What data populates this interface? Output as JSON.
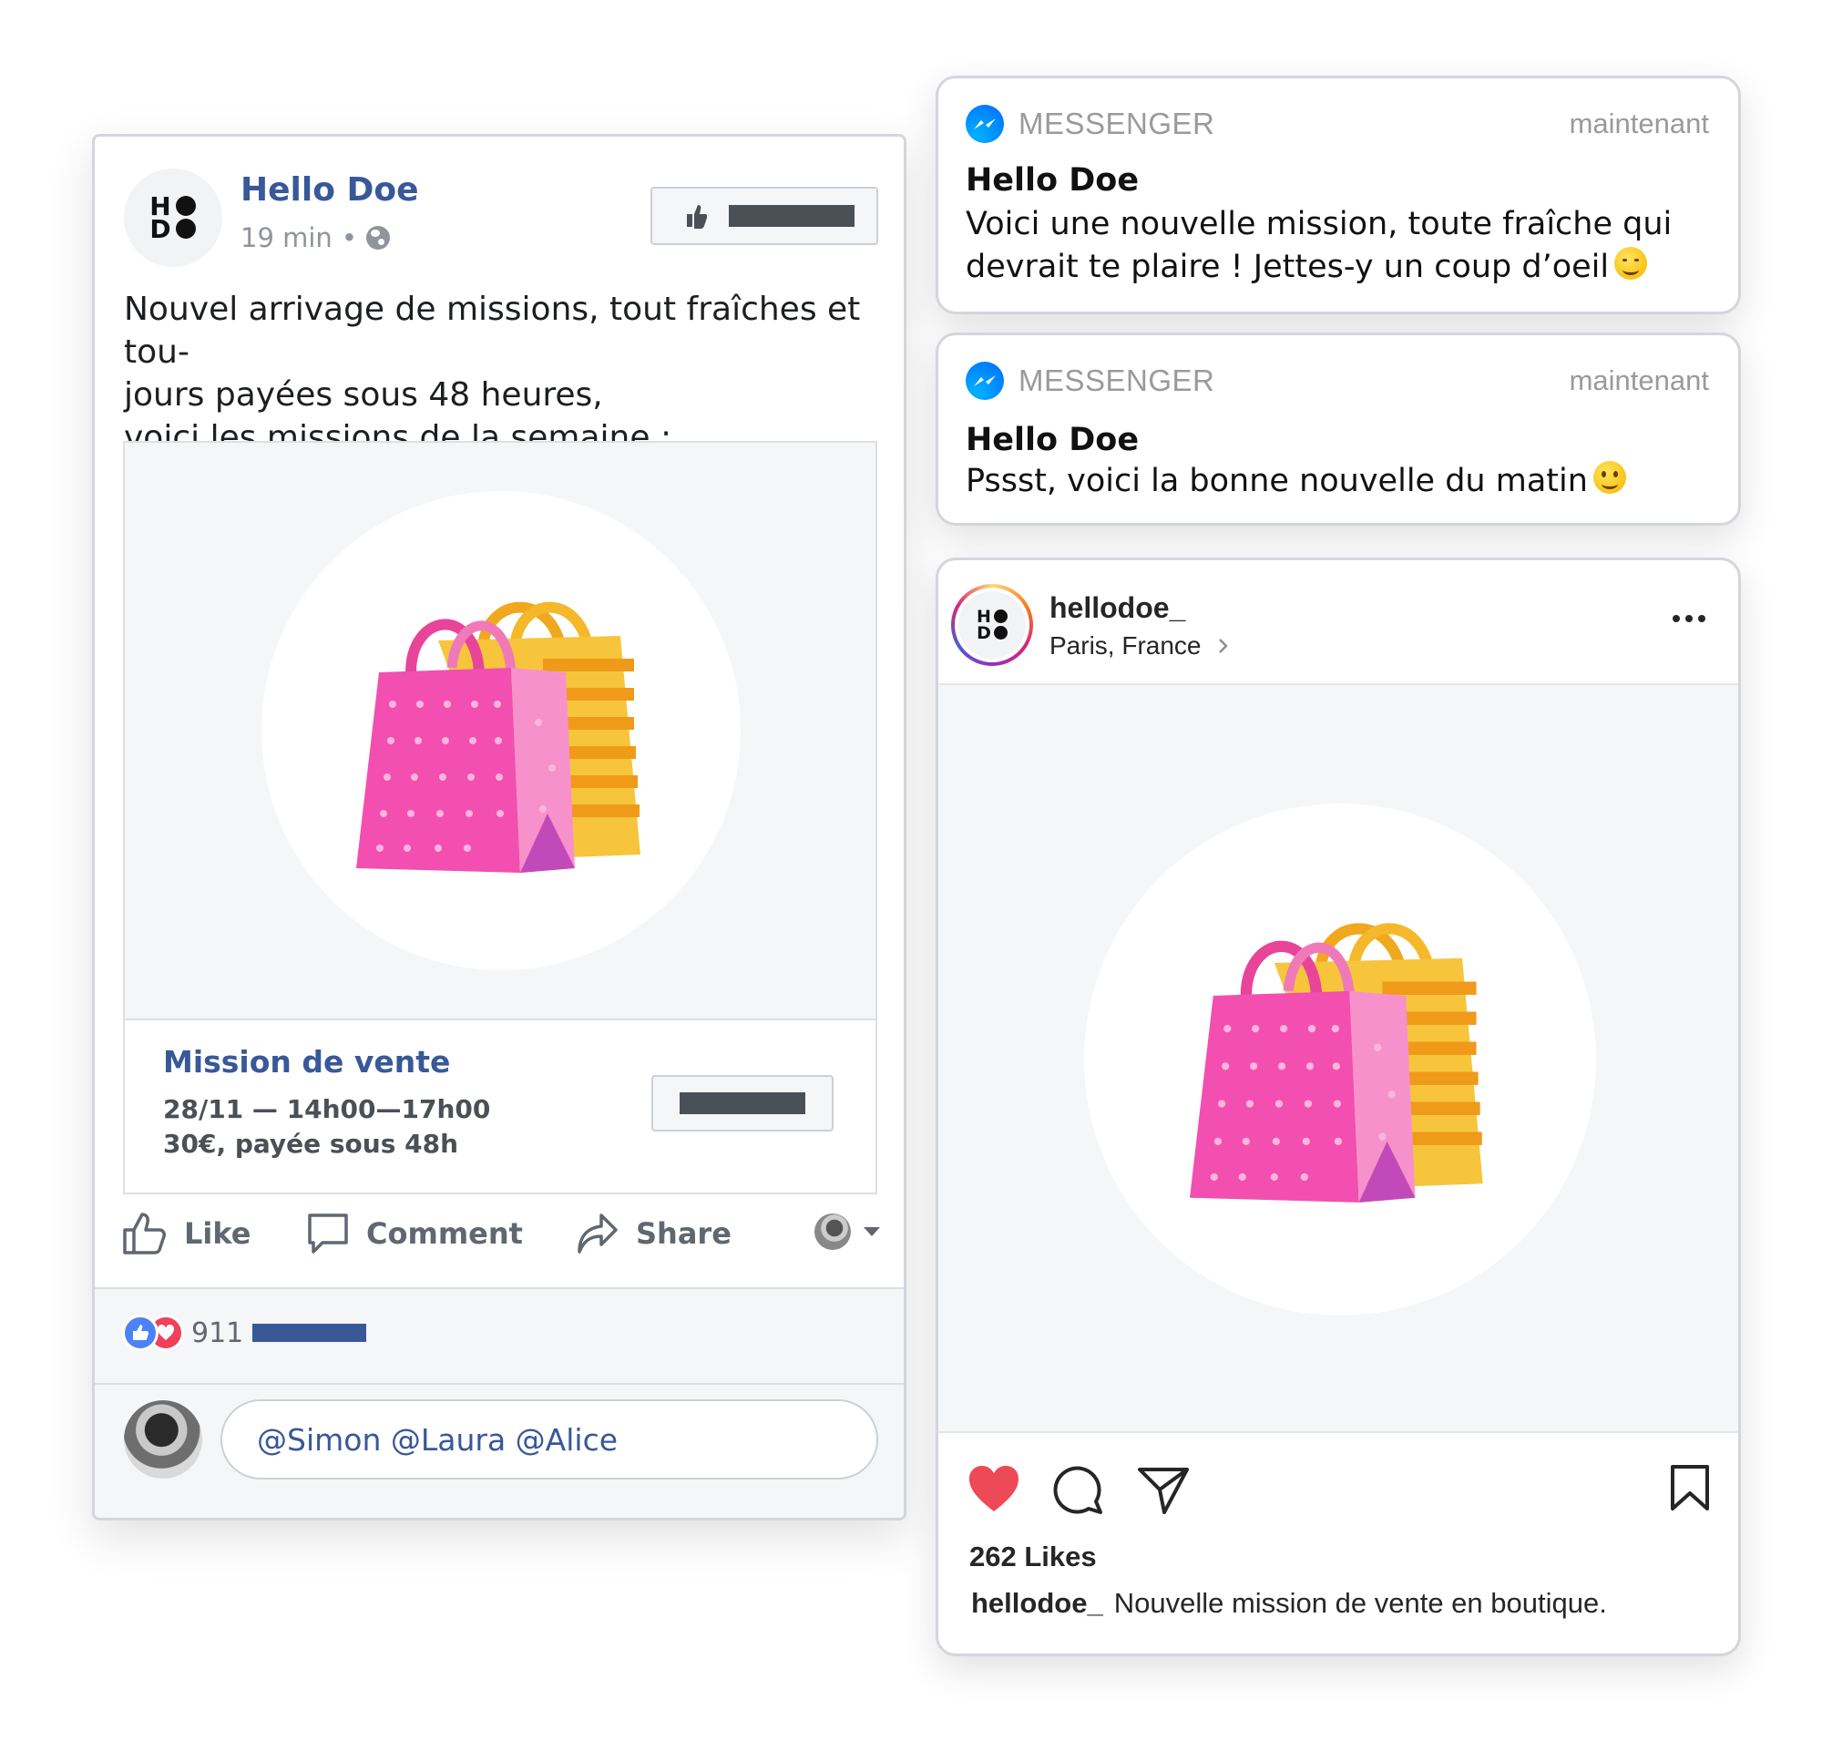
{
  "facebook": {
    "page_name": "Hello Doe",
    "time": "19 min",
    "separator": "•",
    "logo_letters": [
      "H",
      "O",
      "D",
      "O"
    ],
    "post_text_lines": [
      "Nouvel arrivage de missions, tout fraîches et tou-",
      "jours payées sous 48 heures,",
      "voici les missions de la semaine :"
    ],
    "link_title": "Mission de vente",
    "link_sub_1": "28/11 — 14h00—17h00",
    "link_sub_2": "30€, payée sous 48h",
    "actions": {
      "like": "Like",
      "comment": "Comment",
      "share": "Share"
    },
    "reaction_count": "911",
    "comment_input_value": "@Simon @Laura @Alice",
    "colors": {
      "brand": "#385898",
      "muted": "#606770",
      "border": "#dddfe2"
    }
  },
  "notifications": [
    {
      "app": "MESSENGER",
      "time": "maintenant",
      "title": "Hello Doe",
      "body": "Voici une nouvelle mission, toute fraîche qui devrait te plaire ! Jettes-y un coup d’oeil",
      "emoji": "winking-face"
    },
    {
      "app": "MESSENGER",
      "time": "maintenant",
      "title": "Hello Doe",
      "body": "Pssst, voici la bonne nouvelle du matin",
      "emoji": "smiling-face"
    }
  ],
  "instagram": {
    "username": "hellodoe_",
    "location": "Paris, France",
    "likes": "262 Likes",
    "caption_user": "hellodoe_",
    "caption_text": "Nouvelle mission de vente en boutique.",
    "colors": {
      "heart": "#ed4956",
      "text": "#262626"
    }
  },
  "image_subject": "shopping-bags-icon"
}
